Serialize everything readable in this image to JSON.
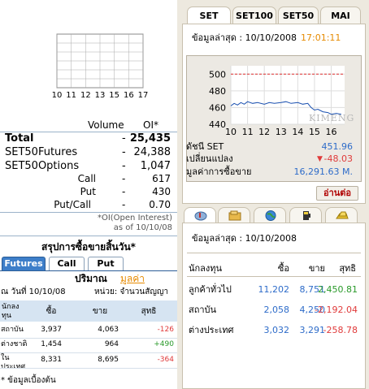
{
  "mini_chart": {
    "x_ticks": [
      "10",
      "11",
      "12",
      "13",
      "15",
      "16",
      "17"
    ]
  },
  "summary": {
    "header_volume": "Volume",
    "header_oi": "OI*",
    "rows": [
      {
        "label": "Total",
        "dash": "-",
        "value": "25,435"
      },
      {
        "label": "SET50Futures",
        "dash": "-",
        "value": "24,388"
      },
      {
        "label": "SET50Options",
        "dash": "-",
        "value": "1,047"
      },
      {
        "label": "Call",
        "dash": "-",
        "value": "617"
      },
      {
        "label": "Put",
        "dash": "-",
        "value": "430"
      },
      {
        "label": "Put/Call",
        "dash": "-",
        "value": "0.70"
      }
    ],
    "note_line1": "*OI(Open Interest)",
    "note_line2": "as of 10/10/08"
  },
  "daily": {
    "title": "สรุปการซื้อขายสิ้นวัน*",
    "tabs": [
      "Futures",
      "Call",
      "Put"
    ],
    "mode_volume": "ปริมาณ",
    "mode_value": "มูลค่า",
    "date_label": "ณ วันที่ 10/10/08",
    "unit_label": "หน่วย: จำนวนสัญญา",
    "headers": {
      "investor": "นักลง\nทุน",
      "buy": "ซื้อ",
      "sell": "ขาย",
      "net": "สุทธิ"
    },
    "rows": [
      {
        "name": "สถาบัน",
        "buy": "3,937",
        "sell": "4,063",
        "net": "-126",
        "net_color": "#e03a3a"
      },
      {
        "name": "ต่างชาติ",
        "buy": "1,454",
        "sell": "964",
        "net": "+490",
        "net_color": "#2a9a2a"
      },
      {
        "name": "ใน\nประเทศ",
        "buy": "8,331",
        "sell": "8,695",
        "net": "-364",
        "net_color": "#e03a3a"
      }
    ],
    "footnote": "* ข้อมูลเบื้องต้น"
  },
  "index_panel": {
    "tabs": [
      "SET",
      "SET100",
      "SET50",
      "MAI"
    ],
    "active_tab": "SET",
    "updated_label": "ข้อมูลล่าสุด : 10/10/2008",
    "updated_time": "17:01:11",
    "stats": [
      {
        "label": "ดัชนี SET",
        "value": "451.96",
        "color": "#2e6cc9"
      },
      {
        "label": "เปลี่ยนแปลง",
        "value": "-48.03",
        "color": "#e03a3a",
        "arrow": "▼"
      },
      {
        "label": "มูลค่าการซื้อขาย",
        "value": "16,291.63 M.",
        "color": "#2e6cc9"
      }
    ],
    "more_button": "อ่านต่อ",
    "watermark": "KIMENG"
  },
  "chart_data": {
    "type": "line",
    "x_ticks": [
      "10",
      "11",
      "12",
      "13",
      "14",
      "15",
      "16"
    ],
    "y_ticks": [
      440,
      460,
      480,
      500
    ],
    "ylim": [
      440,
      510
    ],
    "reference_line": 500,
    "series": [
      {
        "x": [
          10.0,
          10.2,
          10.4,
          10.6,
          10.8,
          11.0,
          11.3,
          11.6,
          12.0,
          12.3,
          12.6,
          13.0,
          13.3,
          13.6,
          14.0,
          14.3,
          14.6,
          14.8,
          15.0,
          15.2,
          15.5,
          15.8,
          16.0,
          16.3,
          16.6
        ],
        "values": [
          462,
          465,
          463,
          466,
          464,
          467,
          465,
          466,
          464,
          466,
          465,
          466,
          467,
          465,
          466,
          464,
          465,
          460,
          457,
          458,
          455,
          454,
          452,
          453,
          452
        ]
      }
    ]
  },
  "investor_panel": {
    "updated_label": "ข้อมูลล่าสุด : 10/10/2008",
    "headers": {
      "investor": "นักลงทุน",
      "buy": "ซื้อ",
      "sell": "ขาย",
      "net": "สุทธิ"
    },
    "rows": [
      {
        "name": "ลูกค้าทั่วไป",
        "buy": "11,202",
        "sell": "8,751",
        "net": "2,450.81",
        "net_color": "#2a9a2a"
      },
      {
        "name": "สถาบัน",
        "buy": "2,058",
        "sell": "4,250",
        "net": "-2,192.04",
        "net_color": "#e03a3a"
      },
      {
        "name": "ต่างประเทศ",
        "buy": "3,032",
        "sell": "3,291",
        "net": "-258.78",
        "net_color": "#e03a3a"
      }
    ],
    "icon_tabs": [
      "chart-icon",
      "folder-icon",
      "globe-icon",
      "fuel-icon",
      "gold-icon"
    ]
  }
}
